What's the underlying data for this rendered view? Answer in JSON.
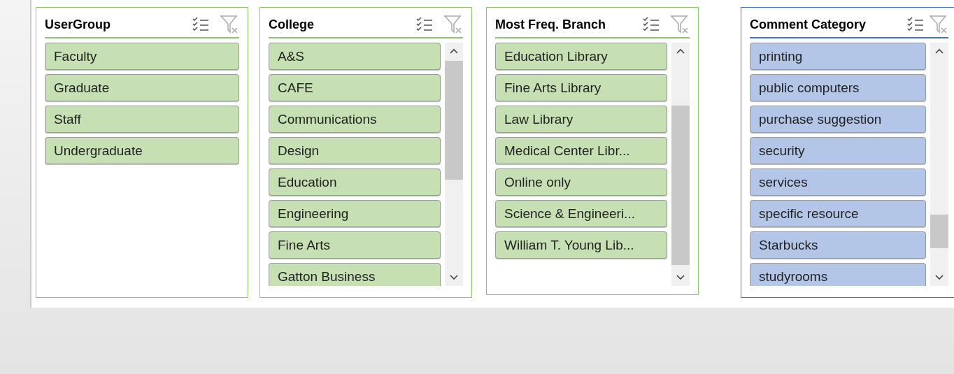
{
  "slicers": [
    {
      "title": "UserGroup",
      "color": "#c6e0b4",
      "scrollbar": false,
      "items": [
        {
          "label": "Faculty",
          "selected": true
        },
        {
          "label": "Graduate",
          "selected": true
        },
        {
          "label": "Staff",
          "selected": true
        },
        {
          "label": "Undergraduate",
          "selected": true
        }
      ]
    },
    {
      "title": "College",
      "color": "#c6e0b4",
      "scrollbar": true,
      "items": [
        {
          "label": "A&S",
          "selected": true
        },
        {
          "label": "CAFE",
          "selected": true
        },
        {
          "label": "Communications",
          "selected": true
        },
        {
          "label": "Design",
          "selected": true
        },
        {
          "label": "Education",
          "selected": true
        },
        {
          "label": "Engineering",
          "selected": true
        },
        {
          "label": "Fine Arts",
          "selected": true
        },
        {
          "label": "Gatton Business",
          "selected": true
        }
      ]
    },
    {
      "title": "Most Freq. Branch",
      "color": "#c6e0b4",
      "scrollbar": true,
      "items": [
        {
          "label": "Education Library",
          "selected": true
        },
        {
          "label": "Fine Arts Library",
          "selected": true
        },
        {
          "label": "Law Library",
          "selected": true
        },
        {
          "label": "Medical Center Libr...",
          "selected": true
        },
        {
          "label": "Online only",
          "selected": true
        },
        {
          "label": "Science & Engineeri...",
          "selected": true
        },
        {
          "label": "William T. Young Lib...",
          "selected": true
        }
      ]
    },
    {
      "title": "Comment Category",
      "color": "#b4c6e7",
      "scrollbar": true,
      "items": [
        {
          "label": "printing",
          "selected": true
        },
        {
          "label": "public computers",
          "selected": true
        },
        {
          "label": "purchase suggestion",
          "selected": true
        },
        {
          "label": "security",
          "selected": true
        },
        {
          "label": "services",
          "selected": true
        },
        {
          "label": "specific resource",
          "selected": true
        },
        {
          "label": "Starbucks",
          "selected": true
        },
        {
          "label": "studyrooms",
          "selected": true
        }
      ]
    }
  ]
}
